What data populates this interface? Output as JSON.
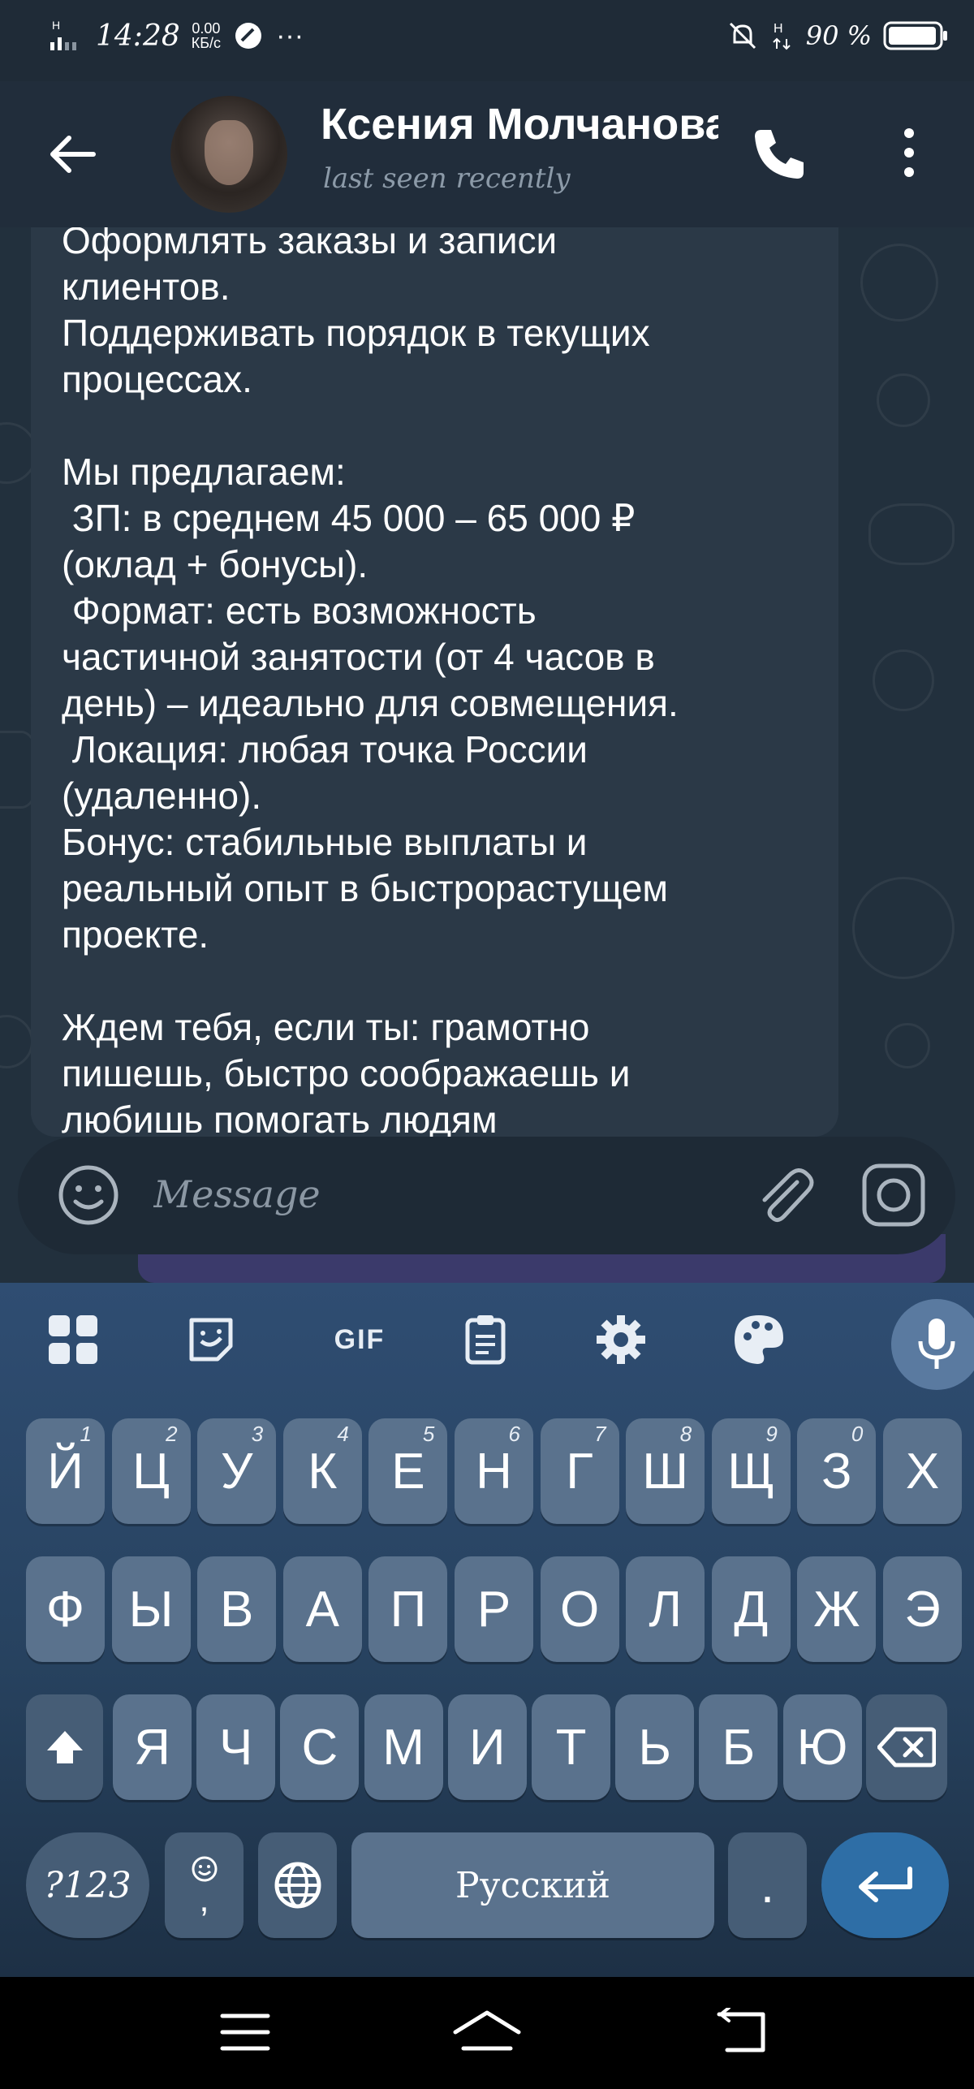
{
  "status_bar": {
    "time": "14:28",
    "speed_value": "0.00",
    "speed_unit": "КБ/с",
    "network_label": "H",
    "battery": "90 %"
  },
  "header": {
    "contact_name": "Ксения Молчанова",
    "last_seen": "last seen recently"
  },
  "message": {
    "text": "Оформлять заказы и записи\nклиентов.\nПоддерживать порядок в текущих\nпроцессах.\n\nМы предлагаем:\n ЗП: в среднем 45 000 – 65 000 ₽\n(оклад + бонусы).\n Формат: есть возможность\nчастичной занятости (от 4 часов в\nдень) – идеально для совмещения.\n Локация: любая точка России\n(удаленно).\nБонус: стабильные выплаты и\nреальный опыт в быстрорастущем\nпроекте.\n\nЖдем тебя, если ты: грамотно\nпишешь, быстро соображаешь и\nлюбишь помогать людям"
  },
  "input": {
    "placeholder": "Message"
  },
  "keyboard": {
    "toolbar_gif": "GIF",
    "row1": [
      {
        "label": "Й",
        "hint": "1"
      },
      {
        "label": "Ц",
        "hint": "2"
      },
      {
        "label": "У",
        "hint": "3"
      },
      {
        "label": "К",
        "hint": "4"
      },
      {
        "label": "Е",
        "hint": "5"
      },
      {
        "label": "Н",
        "hint": "6"
      },
      {
        "label": "Г",
        "hint": "7"
      },
      {
        "label": "Ш",
        "hint": "8"
      },
      {
        "label": "Щ",
        "hint": "9"
      },
      {
        "label": "З",
        "hint": "0"
      },
      {
        "label": "Х",
        "hint": ""
      }
    ],
    "row2": [
      "Ф",
      "Ы",
      "В",
      "А",
      "П",
      "Р",
      "О",
      "Л",
      "Д",
      "Ж",
      "Э"
    ],
    "row3": [
      "Я",
      "Ч",
      "С",
      "М",
      "И",
      "Т",
      "Ь",
      "Б",
      "Ю"
    ],
    "symbols_label": "?123",
    "comma_label": ",",
    "space_label": "Русский",
    "period_label": "."
  },
  "colors": {
    "chat_background": "#22303d",
    "bubble": "#2b3947",
    "keyboard_key": "#5a728d",
    "enter_key": "#2e6ea6"
  },
  "icons": [
    "back-arrow-icon",
    "phone-icon",
    "more-vertical-icon",
    "emoji-icon",
    "paperclip-icon",
    "camera-icon",
    "grid-icon",
    "sticker-icon",
    "clipboard-icon",
    "gear-icon",
    "palette-icon",
    "microphone-icon",
    "shift-icon",
    "backspace-icon",
    "globe-icon",
    "enter-icon",
    "menu-icon",
    "home-icon",
    "back-icon"
  ]
}
